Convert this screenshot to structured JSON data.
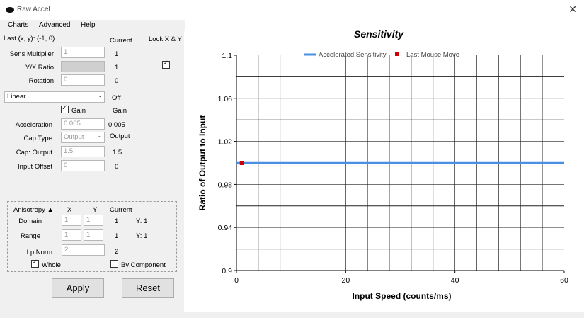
{
  "window": {
    "title": "Raw Accel"
  },
  "menu": {
    "items": [
      "Charts",
      "Advanced",
      "Help"
    ]
  },
  "header": {
    "last_xy": "Last (x, y): (-1, 0)",
    "current": "Current",
    "lock": "Lock X & Y"
  },
  "rows": {
    "sens_label": "Sens Multiplier",
    "sens_value": "1",
    "sens_current": "1",
    "yx_label": "Y/X Ratio",
    "yx_current": "1",
    "rot_label": "Rotation",
    "rot_value": "0",
    "rot_current": "0"
  },
  "mode": {
    "selected": "Linear",
    "status": "Off"
  },
  "gain": {
    "label": "Gain",
    "current": "Gain"
  },
  "accel": {
    "label": "Acceleration",
    "value": "0.005",
    "current": "0.005"
  },
  "cap_type": {
    "label": "Cap Type",
    "selected": "Output",
    "current": "Output"
  },
  "cap_output": {
    "label": "Cap: Output",
    "value": "1.5",
    "current": "1.5"
  },
  "input_offset": {
    "label": "Input Offset",
    "value": "0",
    "current": "0"
  },
  "anisotropy": {
    "header": "Anisotropy ▲",
    "x": "X",
    "y": "Y",
    "current": "Current",
    "domain_label": "Domain",
    "domain_x": "1",
    "domain_y": "1",
    "domain_cur": "1",
    "domain_cur_y": "Y: 1",
    "range_label": "Range",
    "range_x": "1",
    "range_y": "1",
    "range_cur": "1",
    "range_cur_y": "Y: 1",
    "lp_label": "Lp Norm",
    "lp_value": "2",
    "lp_current": "2",
    "whole": "Whole",
    "by_component": "By Component"
  },
  "buttons": {
    "apply": "Apply",
    "reset": "Reset"
  },
  "colors": {
    "series": "#4a90e2",
    "marker": "#cc0000",
    "panel": "#f0f0f0"
  },
  "chart_data": {
    "type": "line",
    "title": "Sensitivity",
    "xlabel": "Input Speed (counts/ms)",
    "ylabel": "Ratio of Output to Input",
    "xlim": [
      0,
      60
    ],
    "ylim": [
      0.9,
      1.1
    ],
    "xticks": [
      "0",
      "20",
      "40",
      "60"
    ],
    "yticks": [
      "0.9",
      "0.94",
      "0.98",
      "1.02",
      "1.06",
      "1.1"
    ],
    "grid": true,
    "legend": "top",
    "series": [
      {
        "name": "Accelerated Sensitivity",
        "x": [
          0,
          60
        ],
        "y": [
          1.0,
          1.0
        ]
      },
      {
        "name": "Last Mouse Move",
        "x": [
          1
        ],
        "y": [
          1.0
        ]
      }
    ]
  }
}
